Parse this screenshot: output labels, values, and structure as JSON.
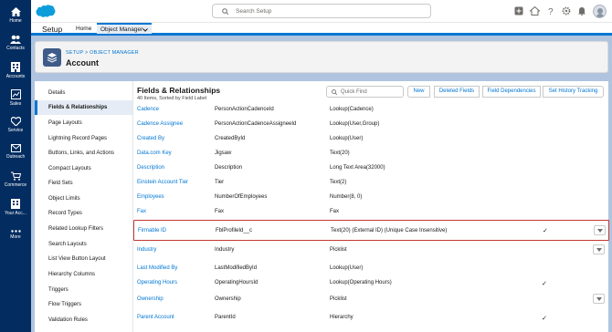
{
  "global_nav": {
    "search_placeholder": "Search Setup",
    "rail": [
      {
        "label": "Home",
        "icon": "home-icon"
      },
      {
        "label": "Contacts",
        "icon": "contacts-icon"
      },
      {
        "label": "Accounts",
        "icon": "accounts-icon"
      },
      {
        "label": "Sales",
        "icon": "sales-icon"
      },
      {
        "label": "Service",
        "icon": "service-icon"
      },
      {
        "label": "Outreach",
        "icon": "outreach-icon"
      },
      {
        "label": "Commerce",
        "icon": "commerce-icon"
      },
      {
        "label": "Your Acc...",
        "icon": "your-account-icon"
      },
      {
        "label": "More",
        "icon": "more-icon"
      }
    ]
  },
  "app_nav": {
    "app_name": "Setup",
    "home": "Home",
    "object_manager": "Object Manager"
  },
  "header": {
    "breadcrumb": "SETUP > OBJECT MANAGER",
    "title": "Account"
  },
  "sidebar": {
    "items": [
      "Details",
      "Fields & Relationships",
      "Page Layouts",
      "Lightning Record Pages",
      "Buttons, Links, and Actions",
      "Compact Layouts",
      "Field Sets",
      "Object Limits",
      "Record Types",
      "Related Lookup Filters",
      "Search Layouts",
      "List View Button Layout",
      "Hierarchy Columns",
      "Triggers",
      "Flow Triggers",
      "Validation Rules"
    ],
    "active_index": 1
  },
  "main": {
    "title": "Fields & Relationships",
    "subtitle": "40 Items, Sorted by Field Label",
    "quick_find_placeholder": "Quick Find",
    "buttons": {
      "new": "New",
      "deleted_fields": "Deleted Fields",
      "field_dependencies": "Field Dependencies",
      "set_history_tracking": "Set History Tracking"
    },
    "rows": [
      {
        "label": "Cadence",
        "api": "PersonActionCadenceId",
        "type": "Lookup(Cadence)",
        "checked": false,
        "menu": false
      },
      {
        "label": "Cadence Assignee",
        "api": "PersonActionCadenceAssigneeId",
        "type": "Lookup(User,Group)",
        "checked": false,
        "menu": false
      },
      {
        "label": "Created By",
        "api": "CreatedById",
        "type": "Lookup(User)",
        "checked": false,
        "menu": false
      },
      {
        "label": "Data.com Key",
        "api": "Jigsaw",
        "type": "Text(20)",
        "checked": false,
        "menu": false
      },
      {
        "label": "Description",
        "api": "Description",
        "type": "Long Text Area(32000)",
        "checked": false,
        "menu": false
      },
      {
        "label": "Einstein Account Tier",
        "api": "Tier",
        "type": "Text(2)",
        "checked": false,
        "menu": false
      },
      {
        "label": "Employees",
        "api": "NumberOfEmployees",
        "type": "Number(8, 0)",
        "checked": false,
        "menu": false
      },
      {
        "label": "Fax",
        "api": "Fax",
        "type": "Fax",
        "checked": false,
        "menu": false
      },
      {
        "label": "Firmable ID",
        "api": "FblProfileId__c",
        "type": "Text(20) (External ID) (Unique Case Insensitive)",
        "checked": true,
        "menu": true,
        "highlighted": true
      },
      {
        "label": "Industry",
        "api": "Industry",
        "type": "Picklist",
        "checked": false,
        "menu": true
      },
      {
        "label": "Last Modified By",
        "api": "LastModifiedById",
        "type": "Lookup(User)",
        "checked": false,
        "menu": false
      },
      {
        "label": "Operating Hours",
        "api": "OperatingHoursId",
        "type": "Lookup(Operating Hours)",
        "checked": true,
        "menu": false
      },
      {
        "label": "Ownership",
        "api": "Ownership",
        "type": "Picklist",
        "checked": false,
        "menu": true
      },
      {
        "label": "Parent Account",
        "api": "ParentId",
        "type": "Hierarchy",
        "checked": true,
        "menu": false
      }
    ]
  },
  "colors": {
    "rail_bg": "#032d60",
    "brand_blue": "#0176d3",
    "highlight_border": "#c23934",
    "page_bg": "#b0c4df"
  }
}
